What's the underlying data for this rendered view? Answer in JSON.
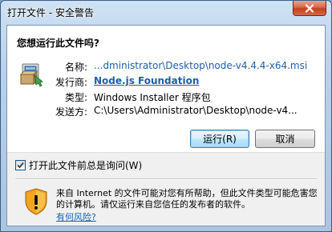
{
  "window": {
    "title": "打开文件 - 安全警告"
  },
  "question": "您想运行此文件吗?",
  "fields": {
    "name_label": "名称:",
    "name_value": "...dministrator\\Desktop\\node-v4.4.4-x64.msi",
    "publisher_label": "发行商:",
    "publisher_value": "Node.js Foundation",
    "type_label": "类型:",
    "type_value": "Windows Installer 程序包",
    "from_label": "发送方:",
    "from_value": "C:\\Users\\Administrator\\Desktop\\node-v4..."
  },
  "buttons": {
    "run": "运行(R)",
    "cancel": "取消"
  },
  "checkbox": {
    "label": "打开此文件前总是询问(W)",
    "checked": true
  },
  "warning": {
    "text": "来自 Internet 的文件可能对您有所帮助，但此文件类型可能危害您的计算机。请仅运行来自您信任的发布者的软件。",
    "link": "有何风险?"
  },
  "icons": {
    "close": "close-icon",
    "installer": "installer-package-icon",
    "shield": "security-shield-icon",
    "check": "check-icon"
  },
  "colors": {
    "link": "#1c5fa8",
    "close_button": "#c2401d",
    "shield_orange": "#f2a51d",
    "default_button_border": "#3c7fb1"
  }
}
